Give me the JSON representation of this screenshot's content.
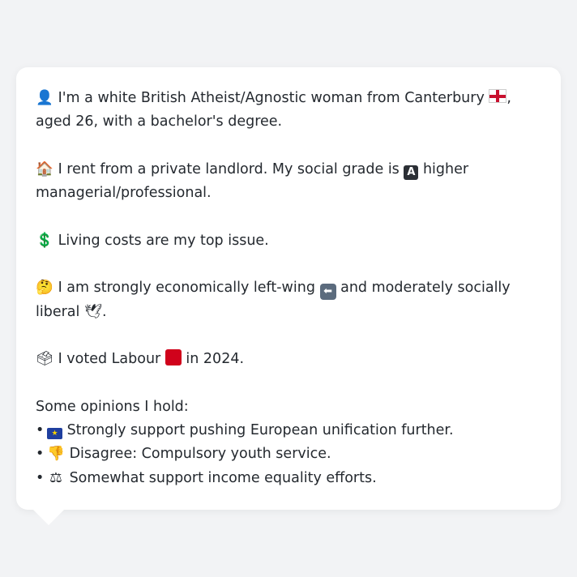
{
  "card": {
    "p1": {
      "icon": "bust-in-silhouette-icon",
      "glyph": "👤",
      "text_a": "I'm a white British Atheist/Agnostic woman from Canterbury",
      "flag": "england-flag-icon",
      "text_b": ", aged 26, with a bachelor's degree."
    },
    "p2": {
      "icon": "house-icon",
      "glyph": "🏠",
      "text_a": "I rent from a private landlord. My social grade is",
      "badge": "A",
      "text_b": "higher managerial/professional."
    },
    "p3": {
      "icon": "dollar-sign-icon",
      "glyph": "💲",
      "text": "Living costs are my top issue."
    },
    "p4": {
      "icon": "thinking-face-icon",
      "glyph": "🤔",
      "text_a": "I am strongly economically left-wing",
      "left_arrow_glyph": "⬅",
      "text_b": "and moderately socially liberal",
      "dove_glyph": "🕊",
      "text_c": "."
    },
    "p5": {
      "icon": "ballot-box-icon",
      "glyph": "🗳",
      "text_a": "I voted Labour",
      "text_b": "in 2024."
    },
    "opinions": {
      "heading": "Some opinions I hold:",
      "bullet": "•",
      "items": [
        {
          "icon": "eu-flag-icon",
          "text": "Strongly support pushing European unification further."
        },
        {
          "icon": "thumbs-down-icon",
          "glyph": "👎",
          "text": "Disagree: Compulsory youth service."
        },
        {
          "icon": "balance-scale-icon",
          "glyph": "⚖",
          "text": "Somewhat support income equality efforts."
        }
      ]
    }
  },
  "colors": {
    "background": "#f2f3f5",
    "card": "#ffffff",
    "text": "#24292f",
    "labour_red": "#d0021b",
    "eu_blue": "#1f3f9f"
  }
}
